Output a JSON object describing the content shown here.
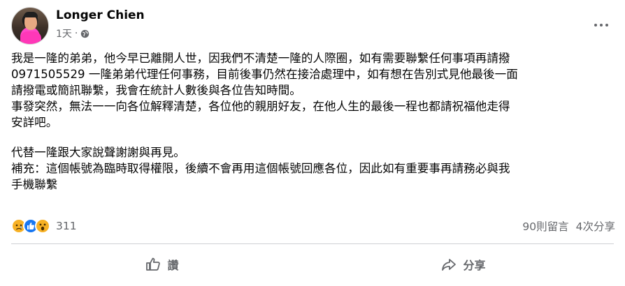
{
  "post": {
    "author": "Longer Chien",
    "time": "1天",
    "separator": "·",
    "privacy_icon": "globe-icon",
    "more_icon": "more-options-icon",
    "lines": [
      "我是一隆的弟弟，他今早已離開人世，因我們不清楚一隆的人際圈，如有需要聯繫任何事項再請撥",
      "0971505529 一隆弟弟代理任何事務，目前後事仍然在接洽處理中，如有想在告別式見他最後一面",
      "請撥電或簡訊聯繫，我會在統計人數後與各位告知時間。",
      "事發突然，無法一一向各位解釋清楚，各位他的親朋好友，在他人生的最後一程也都請祝福他走得",
      "安詳吧。",
      "代替一隆跟大家說聲謝謝與再見。",
      "補充：這個帳號為臨時取得權限，後續不會再用這個帳號回應各位，因此如有重要事再請務必與我",
      "手機聯繫"
    ]
  },
  "reactions": {
    "icons": [
      "sad-reaction-icon",
      "like-reaction-icon",
      "wow-reaction-icon"
    ],
    "count": "311",
    "comments": "90則留言",
    "shares": "4次分享"
  },
  "actions": {
    "like_label": "讚",
    "share_label": "分享"
  },
  "colors": {
    "text": "#050505",
    "secondary": "#65676b",
    "like_blue": "#1877f2",
    "reaction_yellow": "#f7b125",
    "divider": "#ced0d4"
  }
}
